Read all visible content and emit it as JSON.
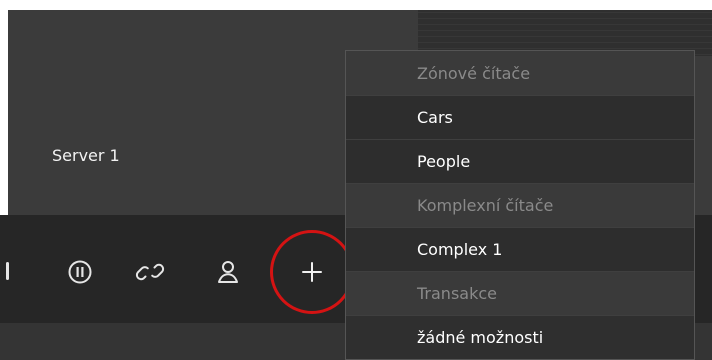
{
  "server": {
    "label": "Server 1"
  },
  "toolbar": {
    "pause_icon": "pause-circle-icon",
    "link_icon": "link-icon",
    "user_icon": "user-icon",
    "plus_icon": "plus-icon",
    "highlight_color": "#d41313"
  },
  "menu": {
    "sections": [
      {
        "header": "Zónové čítače",
        "items": [
          "Cars",
          "People"
        ]
      },
      {
        "header": "Komplexní čítače",
        "items": [
          "Complex 1"
        ]
      },
      {
        "header": "Transakce",
        "items": [
          "žádné možnosti"
        ]
      }
    ]
  }
}
